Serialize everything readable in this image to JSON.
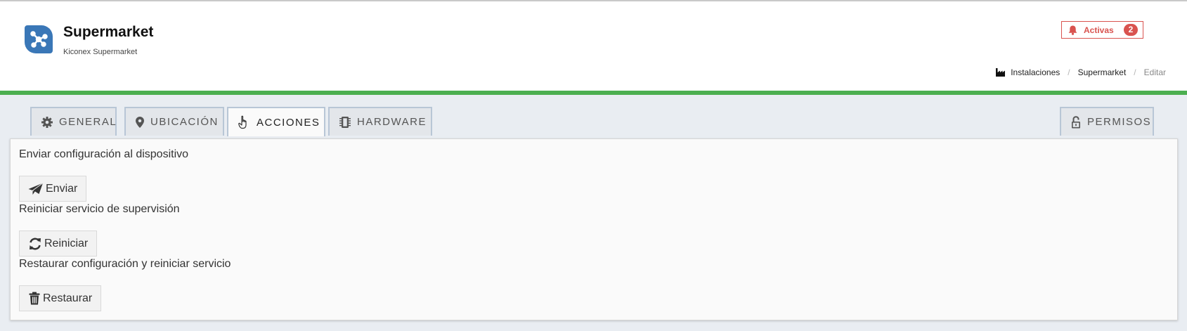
{
  "header": {
    "title": "Supermarket",
    "subtitle": "Kiconex Supermarket",
    "logo_icon": "network-nodes-icon",
    "alerts": {
      "label": "Activas",
      "count": "2",
      "icon": "bell-icon",
      "color": "#d9534f"
    },
    "accent_color": "#4caf50",
    "brand_color": "#3a77b7"
  },
  "breadcrumb": {
    "icon": "factory-icon",
    "items": [
      "Instalaciones",
      "Supermarket",
      "Editar"
    ],
    "separator": "/"
  },
  "tabs": [
    {
      "label": "GENERAL",
      "icon": "gear-icon",
      "active": false
    },
    {
      "label": "UBICACIÓN",
      "icon": "map-marker-icon",
      "active": false
    },
    {
      "label": "ACCIONES",
      "icon": "hand-pointer-icon",
      "active": true
    },
    {
      "label": "HARDWARE",
      "icon": "chip-icon",
      "active": false
    },
    {
      "label": "PERMISOS",
      "icon": "unlock-icon",
      "active": false
    }
  ],
  "actions": [
    {
      "label": "Enviar configuración al dispositivo",
      "button": "Enviar",
      "icon": "paper-plane-icon"
    },
    {
      "label": "Reiniciar servicio de supervisión",
      "button": "Reiniciar",
      "icon": "refresh-icon"
    },
    {
      "label": "Restaurar configuración y reiniciar servicio",
      "button": "Restaurar",
      "icon": "trash-icon"
    }
  ]
}
